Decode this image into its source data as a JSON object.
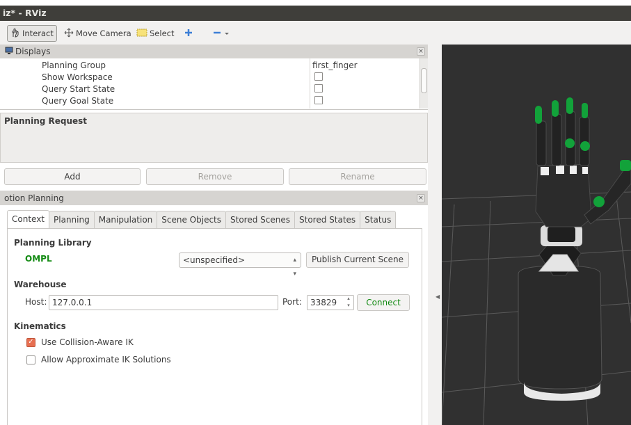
{
  "window": {
    "title": "iz* - RViz"
  },
  "toolbar": {
    "interact": "Interact",
    "move_camera": "Move Camera",
    "select": "Select"
  },
  "displays": {
    "title": "Displays",
    "properties": [
      {
        "name": "Planning Group",
        "value": "first_finger"
      },
      {
        "name": "Show Workspace",
        "checked": false
      },
      {
        "name": "Query Start State",
        "checked": false
      },
      {
        "name": "Query Goal State",
        "checked": false
      }
    ]
  },
  "planning_request": {
    "label": "Planning Request",
    "add": "Add",
    "remove": "Remove",
    "rename": "Rename"
  },
  "motion_planning": {
    "title": "otion Planning",
    "tabs": [
      "Context",
      "Planning",
      "Manipulation",
      "Scene Objects",
      "Stored Scenes",
      "Stored States",
      "Status"
    ],
    "active_tab": "Context",
    "planning_library": {
      "title": "Planning Library",
      "library": "OMPL",
      "planner": "<unspecified>",
      "publish_button": "Publish Current Scene"
    },
    "warehouse": {
      "title": "Warehouse",
      "host_label": "Host:",
      "host": "127.0.0.1",
      "port_label": "Port:",
      "port": "33829",
      "connect_button": "Connect"
    },
    "kinematics": {
      "title": "Kinematics",
      "collision_aware": {
        "label": "Use Collision-Aware IK",
        "checked": true
      },
      "approximate": {
        "label": "Allow Approximate IK Solutions",
        "checked": false
      }
    }
  },
  "colors": {
    "ompl_green": "#128a12",
    "viewport_bg": "#303030",
    "checkbox_accent": "#e76f51"
  }
}
